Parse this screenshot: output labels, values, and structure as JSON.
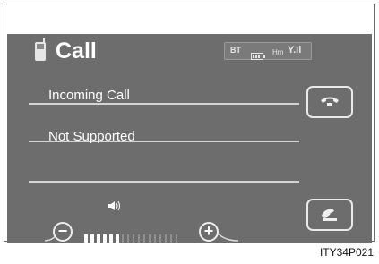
{
  "header": {
    "title": "Call"
  },
  "status": {
    "bluetooth": "BT",
    "home_network": "Hm",
    "signal": "Y.ıl"
  },
  "calls": [
    {
      "label": "Incoming Call"
    },
    {
      "label": "Not Supported"
    },
    {
      "label": ""
    }
  ],
  "volume": {
    "level": 6,
    "max": 17,
    "minus_label": "−",
    "plus_label": "+"
  },
  "buttons": {
    "off_hook_icon": "phone-hangup-icon",
    "send_icon": "phone-icon"
  },
  "caption": "ITY34P021",
  "colors": {
    "screen_bg": "#6d6d6d",
    "active_bar": "#ffffff",
    "inactive_bar": "#8f8f8f"
  }
}
